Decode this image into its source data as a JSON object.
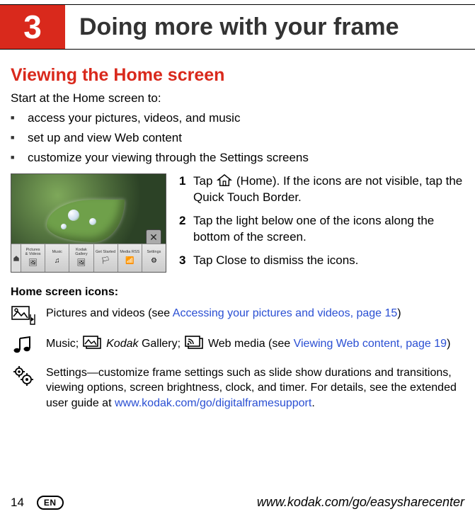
{
  "chapter": {
    "number": "3",
    "title": "Doing more with your frame"
  },
  "section_title": "Viewing the Home screen",
  "intro": "Start at the Home screen to:",
  "bullets": [
    "access your pictures, videos, and music",
    "set up and view Web content",
    "customize your viewing through the Settings screens"
  ],
  "thumbnail": {
    "tiles": [
      "Pictures\n& Videos",
      "Music",
      "Kodak\nGallery",
      "Get Started",
      "Media RSS",
      "Settings"
    ]
  },
  "steps": [
    {
      "n": "1",
      "text_before": "Tap ",
      "text_after": " (Home). If the icons are not visible, tap the Quick Touch Border."
    },
    {
      "n": "2",
      "text": "Tap the light below one of the icons along the bottom of the screen."
    },
    {
      "n": "3",
      "text": "Tap Close to dismiss the icons."
    }
  ],
  "subhead": "Home screen icons:",
  "icons": {
    "pictures": {
      "pre": "Pictures and videos (see ",
      "link": "Accessing your pictures and videos, page 15",
      "post": ")"
    },
    "music": {
      "pre": "Music; ",
      "gallery_italic": "Kodak",
      "gallery_rest": " Gallery; ",
      "webmedia": " Web media (see ",
      "link": "Viewing Web content, page 19",
      "post": ")"
    },
    "settings": {
      "text": "Settings—customize frame settings such as slide show durations and transitions, viewing options, screen brightness, clock, and timer. For details, see the extended user guide at ",
      "link": "www.kodak.com/go/digitalframesupport",
      "post": "."
    }
  },
  "footer": {
    "page": "14",
    "badge": "EN",
    "url": "www.kodak.com/go/easysharecenter"
  }
}
